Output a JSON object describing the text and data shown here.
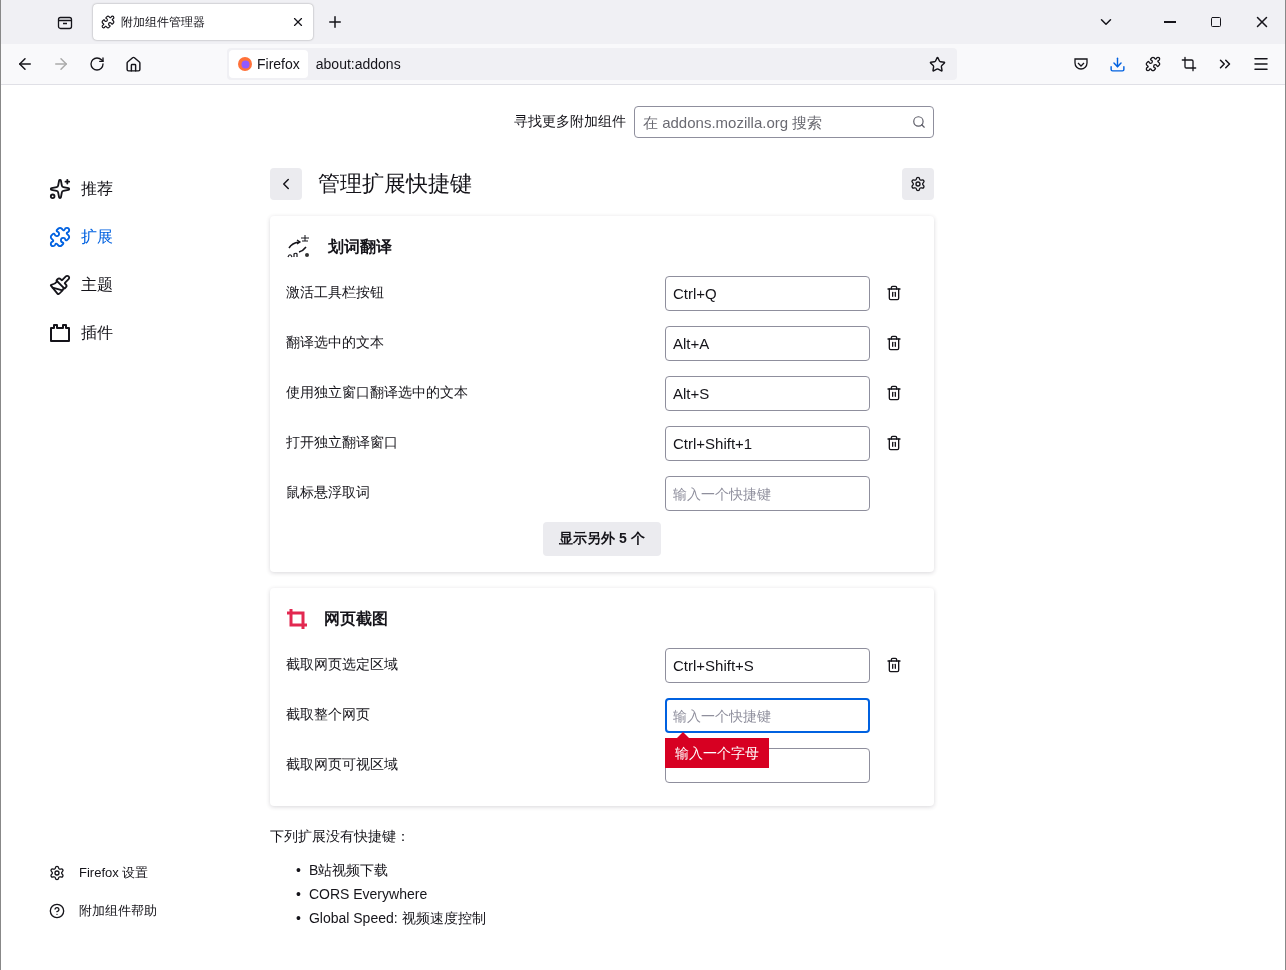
{
  "browser": {
    "tabs": [
      {
        "title": "附加组件管理器",
        "selected": true
      }
    ],
    "identity": "Firefox",
    "url": "about:addons"
  },
  "search": {
    "label": "寻找更多附加组件",
    "placeholder": "在 addons.mozilla.org 搜索"
  },
  "sidebar": {
    "items": [
      {
        "label": "推荐",
        "selected": false
      },
      {
        "label": "扩展",
        "selected": true
      },
      {
        "label": "主题",
        "selected": false
      },
      {
        "label": "插件",
        "selected": false
      }
    ],
    "footer": [
      {
        "label": "Firefox 设置"
      },
      {
        "label": "附加组件帮助"
      }
    ]
  },
  "page": {
    "title": "管理扩展快捷键"
  },
  "extensions": [
    {
      "name": "划词翻译",
      "shortcuts": [
        {
          "label": "激活工具栏按钮",
          "value": "Ctrl+Q",
          "focused": false
        },
        {
          "label": "翻译选中的文本",
          "value": "Alt+A",
          "focused": false
        },
        {
          "label": "使用独立窗口翻译选中的文本",
          "value": "Alt+S",
          "focused": false
        },
        {
          "label": "打开独立翻译窗口",
          "value": "Ctrl+Shift+1",
          "focused": false
        },
        {
          "label": "鼠标悬浮取词",
          "placeholder": "输入一个快捷键",
          "focused": false
        }
      ],
      "more_button": "显示另外 5 个"
    },
    {
      "name": "网页截图",
      "shortcuts": [
        {
          "label": "截取网页选定区域",
          "value": "Ctrl+Shift+S",
          "focused": false
        },
        {
          "label": "截取整个网页",
          "placeholder": "输入一个快捷键",
          "focused": true,
          "error": "输入一个字母"
        },
        {
          "label": "截取网页可视区域",
          "focused": false
        }
      ]
    }
  ],
  "no_shortcuts": {
    "heading": "下列扩展没有快捷键：",
    "items": [
      {
        "marker": "•",
        "text": "B站视频下载"
      },
      {
        "marker": "•",
        "text": "CORS Everywhere"
      },
      {
        "marker": "•",
        "text": "Global Speed: 视频速度控制"
      }
    ]
  }
}
